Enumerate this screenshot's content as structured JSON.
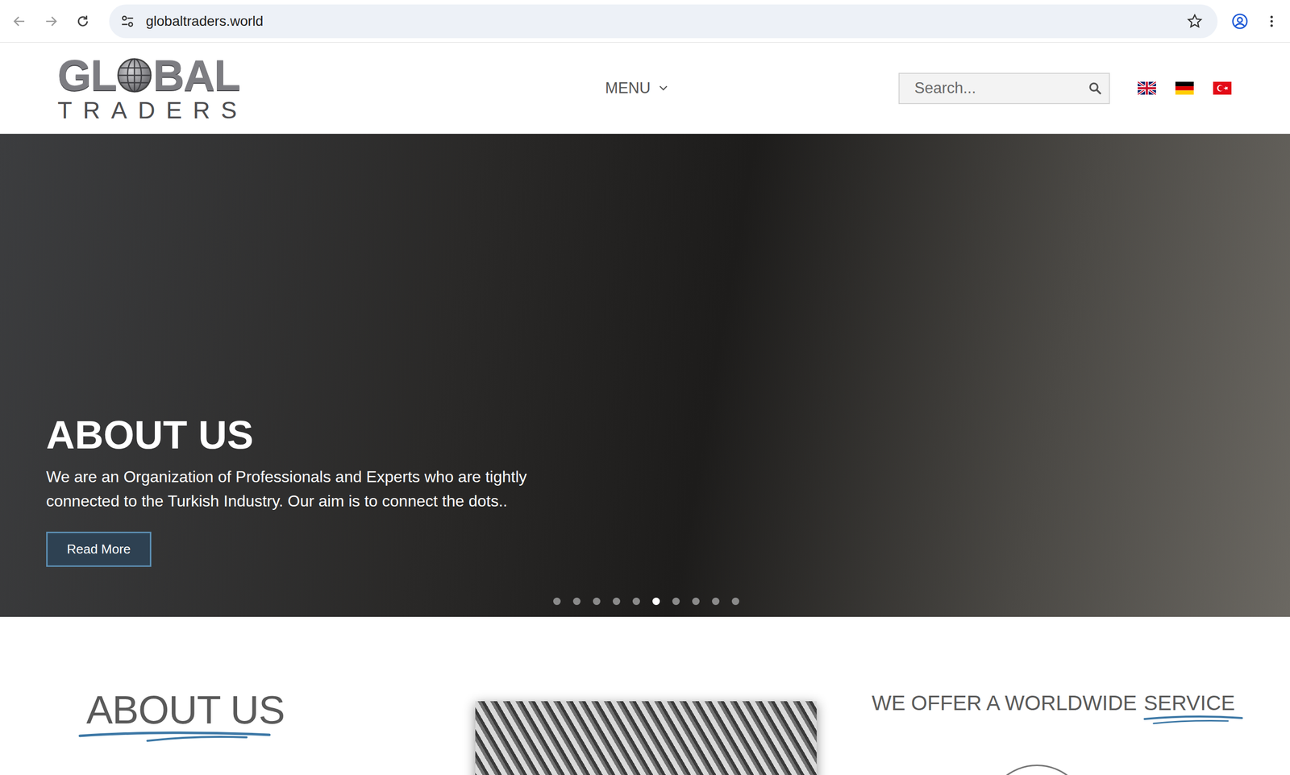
{
  "browser": {
    "url": "globaltraders.world"
  },
  "logo": {
    "left": "GL",
    "right": "BAL",
    "bottom": "TRADERS"
  },
  "menu": {
    "label": "MENU"
  },
  "search": {
    "placeholder": "Search..."
  },
  "languages": [
    {
      "kind": "uk"
    },
    {
      "kind": "de"
    },
    {
      "kind": "tr"
    }
  ],
  "hero": {
    "title": "ABOUT US",
    "text": "We are an Organization of Professionals and Experts who are tightly connected to the Turkish Industry. Our aim is to connect the dots..",
    "button": "Read More",
    "slides": [
      {
        "selected": false
      },
      {
        "selected": false
      },
      {
        "selected": false
      },
      {
        "selected": false
      },
      {
        "selected": false
      },
      {
        "selected": true
      },
      {
        "selected": false
      },
      {
        "selected": false
      },
      {
        "selected": false
      },
      {
        "selected": false
      }
    ]
  },
  "about": {
    "title": "ABOUT US"
  },
  "service": {
    "text": "WE OFFER A WORLDWIDE",
    "highlight": "SERVICE"
  }
}
